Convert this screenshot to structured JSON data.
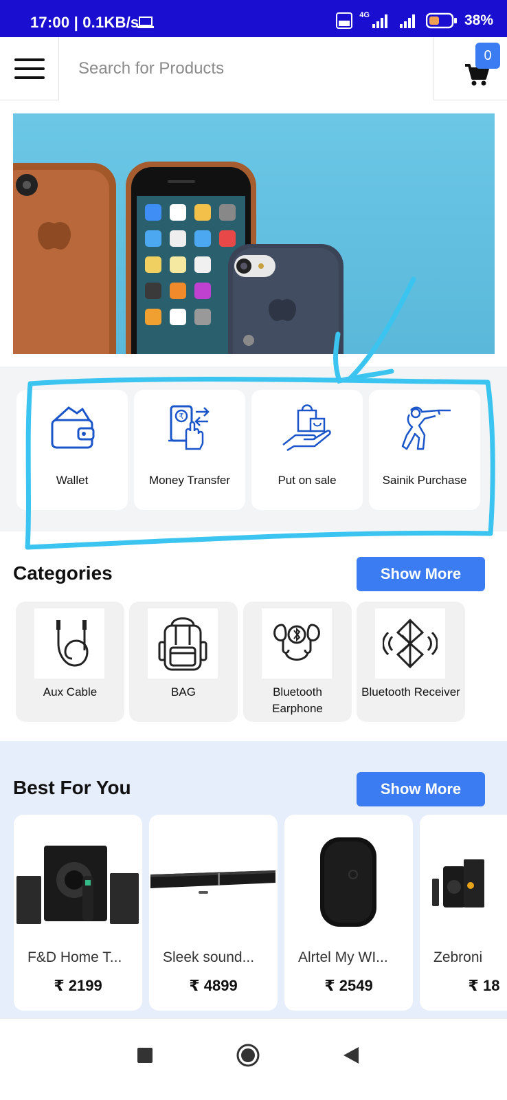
{
  "status_bar": {
    "time": "17:00 | 0.1KB/s",
    "network": "4G",
    "battery": "38%"
  },
  "header": {
    "search_placeholder": "Search for Products",
    "cart_count": "0"
  },
  "services": [
    {
      "label": "Wallet",
      "icon": "wallet-icon"
    },
    {
      "label": "Money Transfer",
      "icon": "money-transfer-icon"
    },
    {
      "label": "Put on sale",
      "icon": "put-on-sale-icon"
    },
    {
      "label": "Sainik Purchase",
      "icon": "soldier-icon"
    }
  ],
  "categories": {
    "title": "Categories",
    "show_more": "Show More",
    "items": [
      {
        "label": "Aux Cable",
        "icon": "aux-cable-icon"
      },
      {
        "label": "BAG",
        "icon": "bag-icon"
      },
      {
        "label": "Bluetooth Earphone",
        "icon": "bluetooth-earphone-icon"
      },
      {
        "label": "Bluetooth Receiver",
        "icon": "bluetooth-receiver-icon"
      }
    ]
  },
  "best_for_you": {
    "title": "Best For You",
    "show_more": "Show More",
    "products": [
      {
        "name": "F&D Home T...",
        "price": "₹ 2199"
      },
      {
        "name": "Sleek sound...",
        "price": "₹ 4899"
      },
      {
        "name": "Alrtel My WI...",
        "price": "₹ 2549"
      },
      {
        "name": "Zebroni",
        "price": "₹ 18"
      }
    ]
  },
  "colors": {
    "status_bar": "#1a0fd0",
    "accent": "#3b7cf2",
    "icon_blue": "#1a56c9",
    "highlight_stroke": "#3cc4f0",
    "best_bg": "#e6edfb"
  }
}
